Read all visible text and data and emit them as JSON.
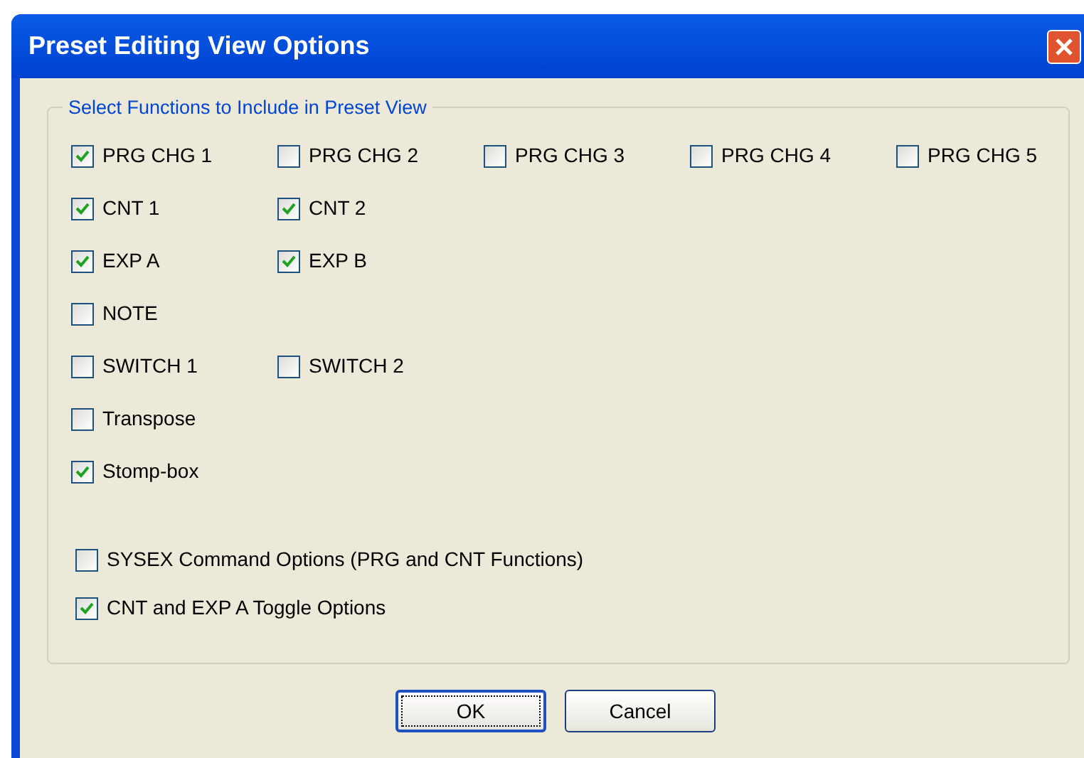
{
  "window": {
    "title": "Preset Editing View Options"
  },
  "group": {
    "legend": "Select Functions to Include in Preset View",
    "rows": [
      [
        {
          "label": "PRG CHG 1",
          "checked": true
        },
        {
          "label": "PRG CHG 2",
          "checked": false
        },
        {
          "label": "PRG CHG 3",
          "checked": false
        },
        {
          "label": "PRG CHG 4",
          "checked": false
        },
        {
          "label": "PRG CHG 5",
          "checked": false
        }
      ],
      [
        {
          "label": "CNT 1",
          "checked": true
        },
        {
          "label": "CNT 2",
          "checked": true
        }
      ],
      [
        {
          "label": "EXP A",
          "checked": true
        },
        {
          "label": "EXP B",
          "checked": true
        }
      ],
      [
        {
          "label": "NOTE",
          "checked": false
        }
      ],
      [
        {
          "label": "SWITCH 1",
          "checked": false
        },
        {
          "label": "SWITCH 2",
          "checked": false
        }
      ],
      [
        {
          "label": "Transpose",
          "checked": false
        }
      ],
      [
        {
          "label": "Stomp-box",
          "checked": true
        }
      ]
    ],
    "options": [
      {
        "label": "SYSEX Command Options (PRG and CNT Functions)",
        "checked": false
      },
      {
        "label": "CNT and EXP A Toggle Options",
        "checked": true
      }
    ]
  },
  "buttons": [
    {
      "label": "OK",
      "default": true
    },
    {
      "label": "Cancel",
      "default": false
    }
  ]
}
